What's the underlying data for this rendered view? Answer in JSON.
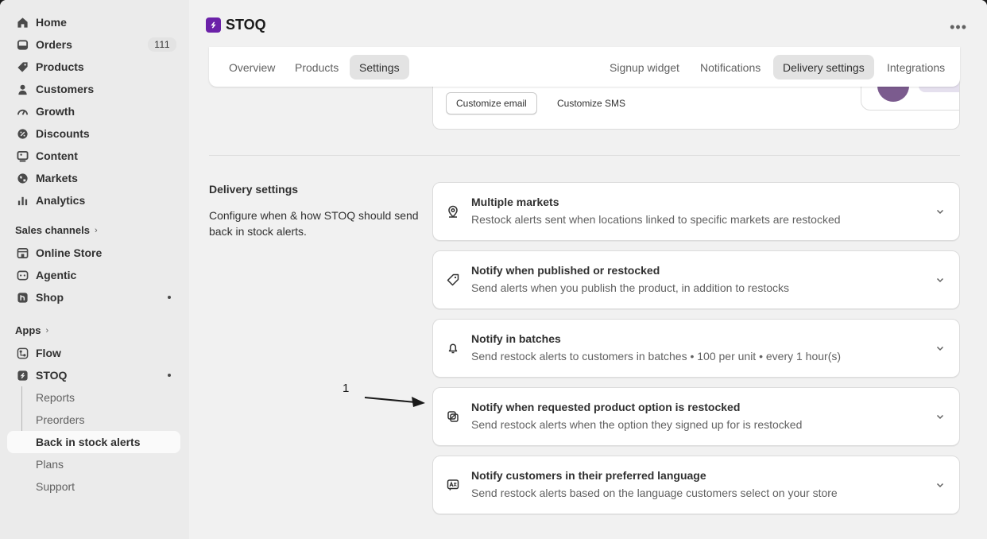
{
  "sidebar": {
    "nav": [
      {
        "label": "Home",
        "icon": "home-icon"
      },
      {
        "label": "Orders",
        "icon": "inbox-icon",
        "badge": "111"
      },
      {
        "label": "Products",
        "icon": "tag-icon"
      },
      {
        "label": "Customers",
        "icon": "person-icon"
      },
      {
        "label": "Growth",
        "icon": "gauge-icon"
      },
      {
        "label": "Discounts",
        "icon": "discount-icon"
      },
      {
        "label": "Content",
        "icon": "image-icon"
      },
      {
        "label": "Markets",
        "icon": "globe-icon"
      },
      {
        "label": "Analytics",
        "icon": "bar-chart-icon"
      }
    ],
    "sales_channels_title": "Sales channels",
    "channels": [
      {
        "label": "Online Store",
        "icon": "store-icon"
      },
      {
        "label": "Agentic",
        "icon": "agentic-icon"
      },
      {
        "label": "Shop",
        "icon": "shop-icon"
      }
    ],
    "apps_title": "Apps",
    "apps": [
      {
        "label": "Flow",
        "icon": "flow-icon"
      },
      {
        "label": "STOQ",
        "icon": "stoq-icon"
      }
    ],
    "stoq_sub": [
      "Reports",
      "Preorders",
      "Back in stock alerts",
      "Plans",
      "Support"
    ]
  },
  "header": {
    "app_name": "STOQ",
    "more_label": "•••"
  },
  "tabs_left": [
    "Overview",
    "Products",
    "Settings"
  ],
  "tabs_right": [
    "Signup widget",
    "Notifications",
    "Delivery settings",
    "Integrations"
  ],
  "prev_card": {
    "customize_email": "Customize email",
    "customize_sms": "Customize SMS"
  },
  "delivery": {
    "heading": "Delivery settings",
    "description": "Configure when & how STOQ should send back in stock alerts.",
    "cards": [
      {
        "title": "Multiple markets",
        "desc": "Restock alerts sent when locations linked to specific markets are restocked",
        "icon": "location-pin-icon"
      },
      {
        "title": "Notify when published or restocked",
        "desc": "Send alerts when you publish the product, in addition to restocks",
        "icon": "tag-icon"
      },
      {
        "title": "Notify in batches",
        "desc": "Send restock alerts to customers in batches • 100 per unit • every 1 hour(s)",
        "icon": "bell-icon"
      },
      {
        "title": "Notify when requested product option is restocked",
        "desc": "Send restock alerts when the option they signed up for is restocked",
        "icon": "variant-icon"
      },
      {
        "title": "Notify customers in their preferred language",
        "desc": "Send restock alerts based on the language customers select on your store",
        "icon": "language-icon"
      }
    ]
  },
  "annotation": {
    "number": "1"
  },
  "colors": {
    "accent": "#6b21a8",
    "active_tab": "#e3e3e3",
    "sidebar_bg": "#ebebeb"
  }
}
